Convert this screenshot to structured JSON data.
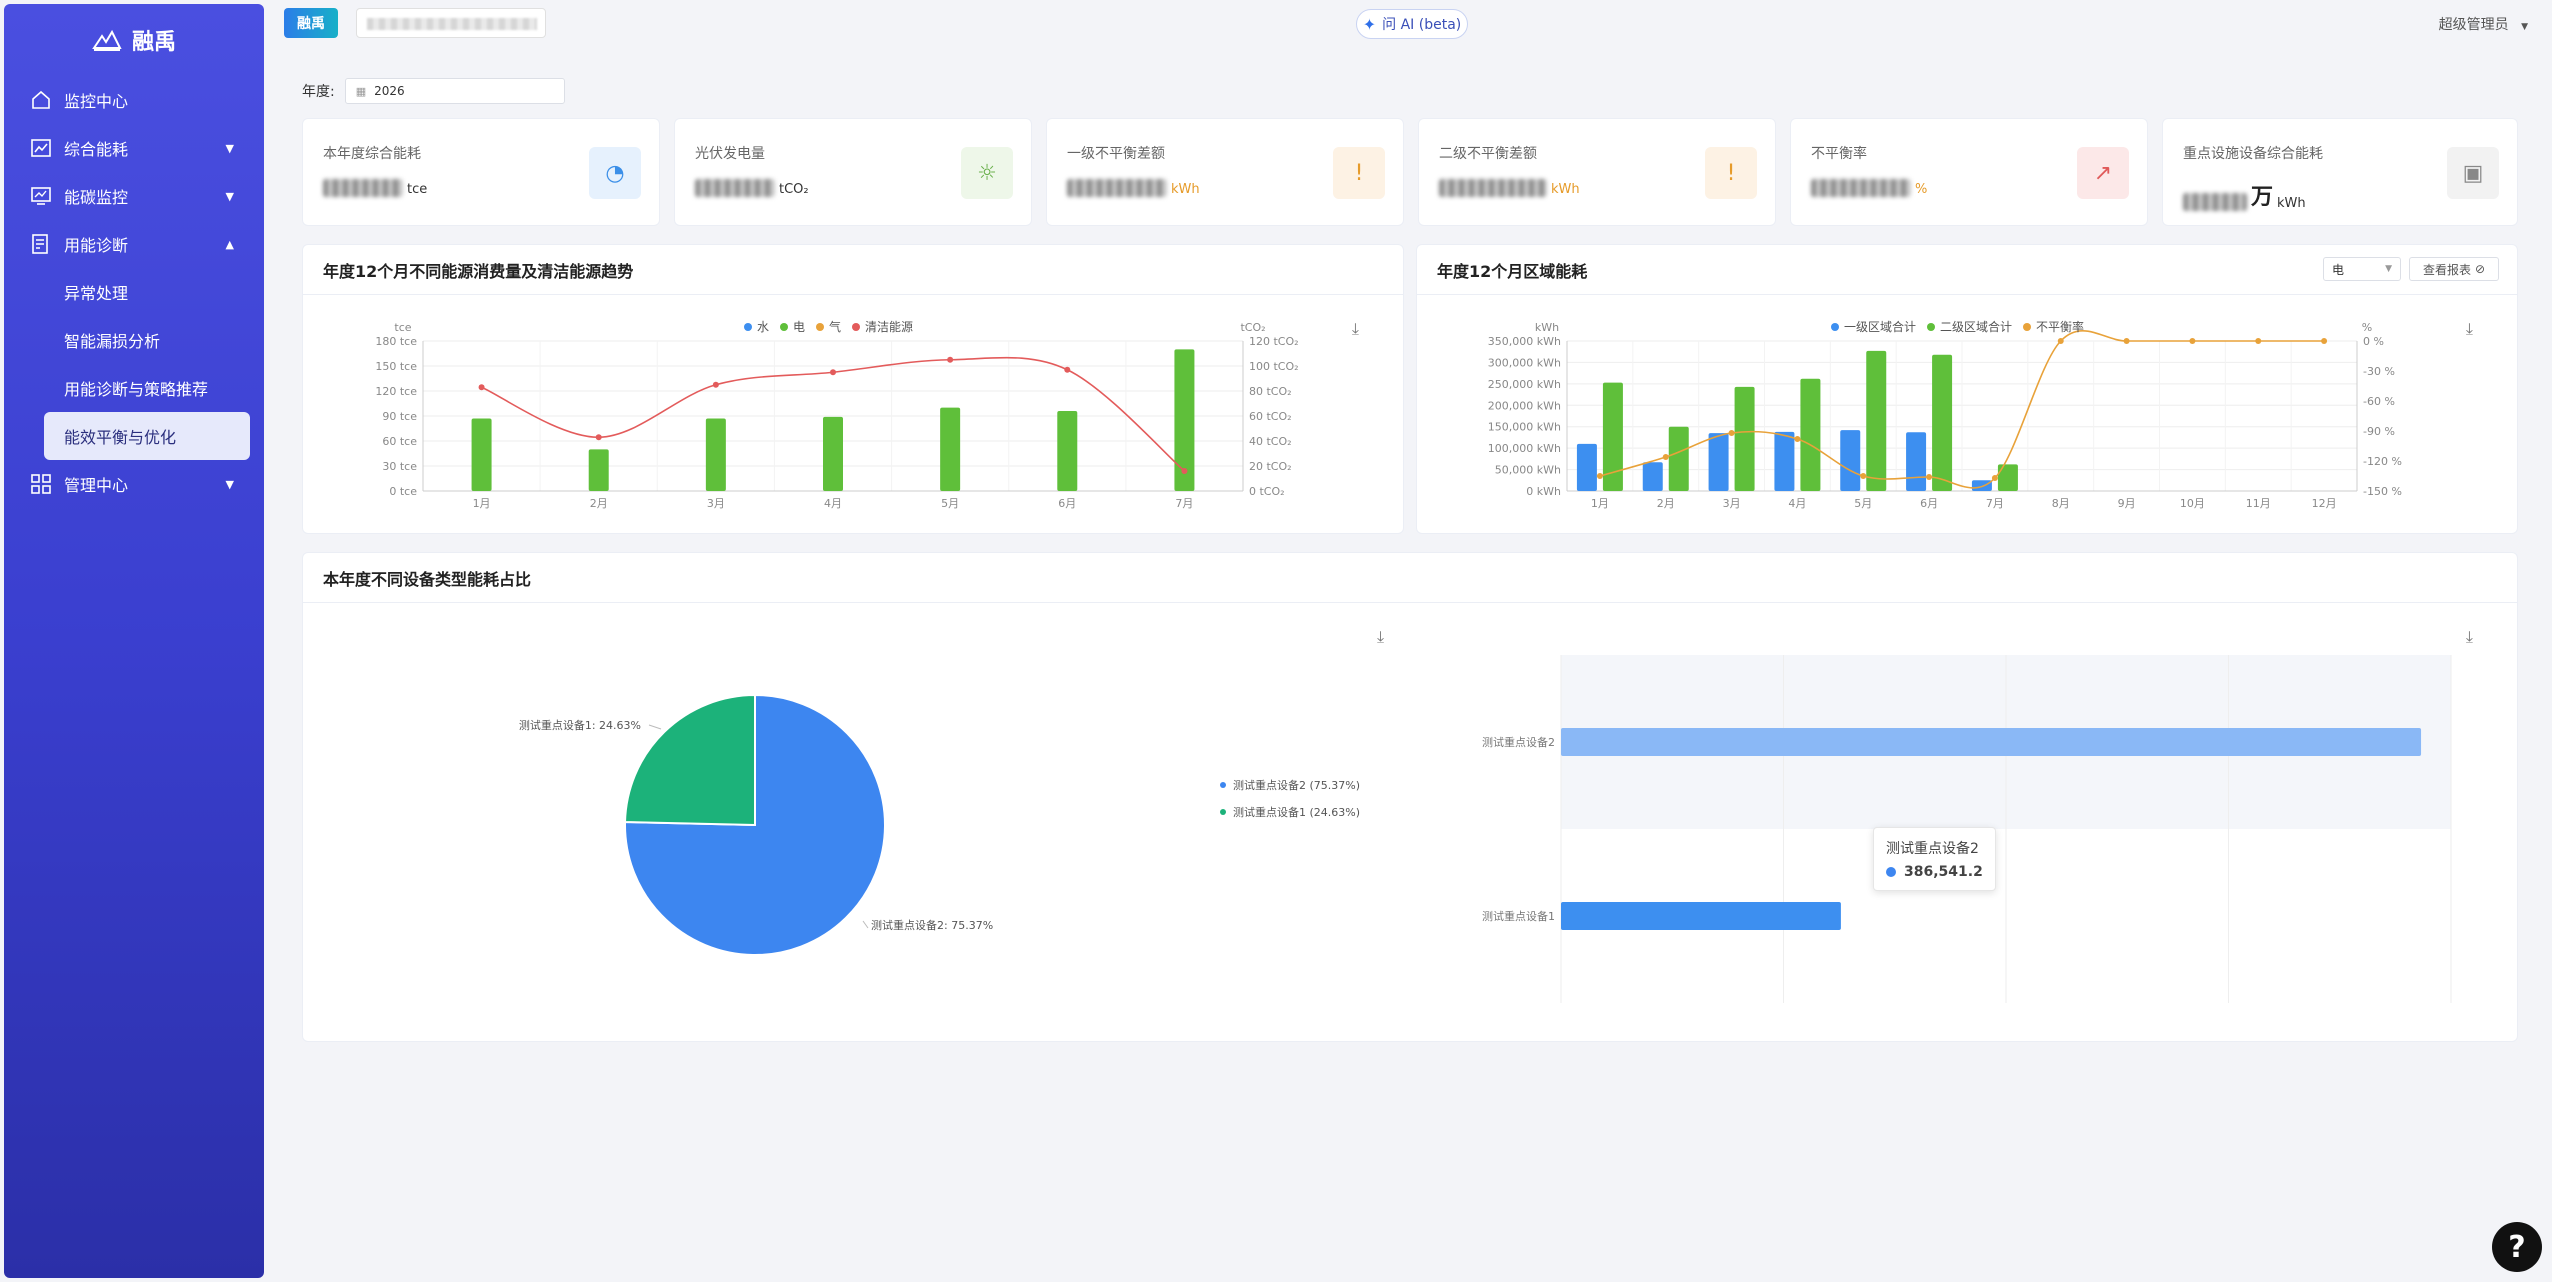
{
  "sidebar": {
    "logo_text": "融禹",
    "items": [
      {
        "label": "监控中心",
        "icon": "home-icon"
      },
      {
        "label": "综合能耗",
        "icon": "chart-icon"
      },
      {
        "label": "能碳监控",
        "icon": "monitor-icon"
      },
      {
        "label": "用能诊断",
        "icon": "diagnose-icon"
      },
      {
        "label": "管理中心",
        "icon": "grid-icon"
      }
    ],
    "sub_items": [
      {
        "label": "异常处理"
      },
      {
        "label": "智能漏损分析"
      },
      {
        "label": "用能诊断与策略推荐"
      },
      {
        "label": "能效平衡与优化"
      }
    ]
  },
  "topbar": {
    "brand_label": "融禹",
    "ai_label": "问 AI (beta)",
    "user_label": "超级管理员"
  },
  "filter": {
    "year_label": "年度:",
    "year_value": "2026"
  },
  "cards": [
    {
      "title": "本年度综合能耗",
      "unit": "tce",
      "icon": "gauge-icon",
      "icon_color": "#3b8fe8",
      "icon_bg": "#e6f1fd",
      "icon_glyph": "◔"
    },
    {
      "title": "光伏发电量",
      "unit": "tCO₂",
      "icon": "sun-icon",
      "icon_color": "#6ab04c",
      "icon_bg": "#eef7e9",
      "icon_glyph": "☼"
    },
    {
      "title": "一级不平衡差额",
      "unit": "kWh",
      "icon": "alert-icon",
      "icon_color": "#e69b2a",
      "icon_bg": "#fdf2e4",
      "icon_glyph": "!"
    },
    {
      "title": "二级不平衡差额",
      "unit": "kWh",
      "icon": "alert-icon",
      "icon_color": "#e69b2a",
      "icon_bg": "#fdf2e4",
      "icon_glyph": "!"
    },
    {
      "title": "不平衡率",
      "unit": "%",
      "icon": "trend-icon",
      "icon_color": "#e05a5a",
      "icon_bg": "#fce8e8",
      "icon_glyph": "↗"
    },
    {
      "title": "重点设施设备综合能耗",
      "unit": "kWh",
      "value_suffix": "万",
      "icon": "chip-icon",
      "icon_color": "#888888",
      "icon_bg": "#f2f2f2",
      "icon_glyph": "▣"
    }
  ],
  "panels": {
    "trend_title": "年度12个月不同能源消费量及清洁能源趋势",
    "region_title": "年度12个月区域能耗",
    "region_select": "电",
    "region_report": "查看报表",
    "pie_title": "本年度不同设备类型能耗占比"
  },
  "chart_data": [
    {
      "type": "bar",
      "ylabel_left": "tce",
      "ylabel_right": "tCO₂",
      "categories": [
        "1月",
        "2月",
        "3月",
        "4月",
        "5月",
        "6月",
        "7月"
      ],
      "legend": [
        "水",
        "电",
        "气",
        "清洁能源"
      ],
      "legend_colors": [
        "#3d8ff0",
        "#5fbf3a",
        "#e8a23a",
        "#e35b5b"
      ],
      "ylim_left": [
        0,
        180
      ],
      "ylim_right": [
        0,
        120
      ],
      "ticks_left": [
        "0 tce",
        "30 tce",
        "60 tce",
        "90 tce",
        "120 tce",
        "150 tce",
        "180 tce"
      ],
      "ticks_right": [
        "0 tCO₂",
        "20 tCO₂",
        "40 tCO₂",
        "60 tCO₂",
        "80 tCO₂",
        "100 tCO₂",
        "120 tCO₂"
      ],
      "series": [
        {
          "name": "电",
          "kind": "bar",
          "axis": "left",
          "values": [
            87,
            50,
            87,
            89,
            100,
            96,
            170
          ]
        },
        {
          "name": "清洁能源",
          "kind": "line",
          "axis": "right",
          "values": [
            83,
            43,
            85,
            95,
            105,
            97,
            16
          ]
        }
      ]
    },
    {
      "type": "bar",
      "ylabel_left": "kWh",
      "ylabel_right": "%",
      "categories": [
        "1月",
        "2月",
        "3月",
        "4月",
        "5月",
        "6月",
        "7月",
        "8月",
        "9月",
        "10月",
        "11月",
        "12月"
      ],
      "legend": [
        "一级区域合计",
        "二级区域合计",
        "不平衡率"
      ],
      "legend_colors": [
        "#3d8ff0",
        "#5fbf3a",
        "#e8a23a"
      ],
      "ylim_left": [
        0,
        350000
      ],
      "ylim_right": [
        -150,
        0
      ],
      "ticks_left": [
        "0 kWh",
        "50,000 kWh",
        "100,000 kWh",
        "150,000 kWh",
        "200,000 kWh",
        "250,000 kWh",
        "300,000 kWh",
        "350,000 kWh"
      ],
      "ticks_right": [
        "-150 %",
        "-120 %",
        "-90 %",
        "-60 %",
        "-30 %",
        "0 %"
      ],
      "series": [
        {
          "name": "一级区域合计",
          "kind": "bar",
          "axis": "left",
          "values": [
            110000,
            67000,
            135000,
            138000,
            142000,
            137000,
            25000,
            0,
            0,
            0,
            0,
            0
          ]
        },
        {
          "name": "二级区域合计",
          "kind": "bar",
          "axis": "left",
          "values": [
            253000,
            150000,
            243000,
            262000,
            327000,
            318000,
            62000,
            0,
            0,
            0,
            0,
            0
          ]
        },
        {
          "name": "不平衡率",
          "kind": "line",
          "axis": "right",
          "values": [
            -135,
            -116,
            -92,
            -98,
            -135,
            -136,
            -137,
            0,
            0,
            0,
            0,
            0
          ]
        }
      ]
    },
    {
      "type": "pie",
      "slices": [
        {
          "name": "测试重点设备2",
          "value": 75.37,
          "color": "#3d86f0",
          "label": "测试重点设备2: 75.37%",
          "legend": "测试重点设备2 (75.37%)"
        },
        {
          "name": "测试重点设备1",
          "value": 24.63,
          "color": "#1cb27a",
          "label": "测试重点设备1: 24.63%",
          "legend": "测试重点设备1 (24.63%)"
        }
      ]
    },
    {
      "type": "bar",
      "orientation": "horizontal",
      "categories": [
        "测试重点设备2",
        "测试重点设备1"
      ],
      "values": [
        386541.2,
        125800
      ],
      "tooltip": {
        "name": "测试重点设备2",
        "value": "386,541.2"
      }
    }
  ]
}
